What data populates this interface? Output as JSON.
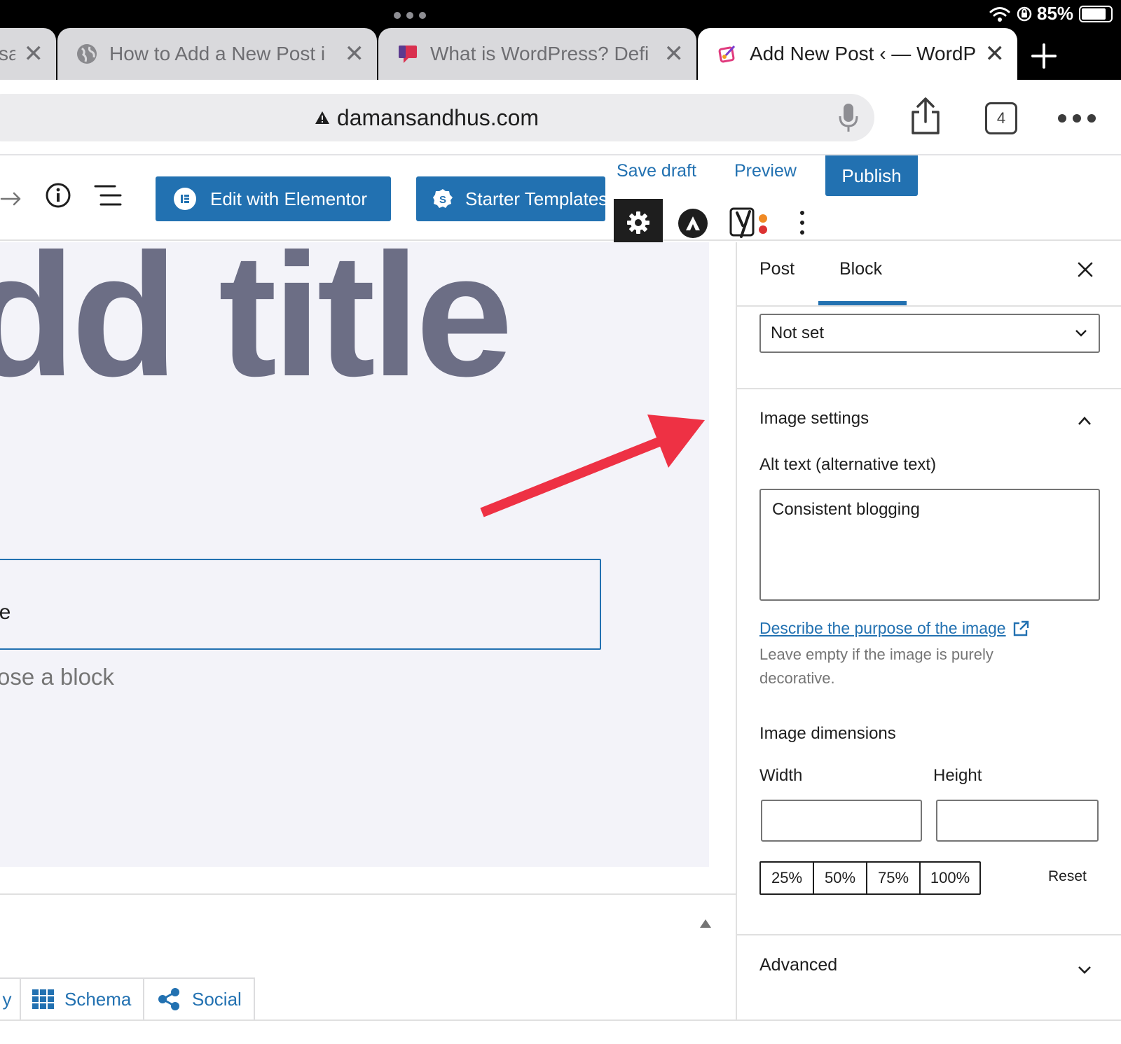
{
  "status_bar": {
    "battery": "85%"
  },
  "tabs": [
    {
      "title": "sa",
      "active": false
    },
    {
      "title": "How to Add a New Post i",
      "active": false
    },
    {
      "title": "What is WordPress? Defi",
      "active": false
    },
    {
      "title": "Add New Post ‹ — WordP",
      "active": true
    }
  ],
  "address_bar": {
    "url": "damansandhus.com",
    "tab_count": "4"
  },
  "toolbar": {
    "edit_elementor_label": "Edit with Elementor",
    "starter_templates_label": "Starter Templates",
    "save_draft_label": "Save draft",
    "preview_label": "Preview",
    "publish_label": "Publish"
  },
  "canvas": {
    "title_placeholder": "dd title",
    "image_block_text": "le",
    "choose_block_text": "ose a block"
  },
  "sidebar": {
    "tabs": [
      "Post",
      "Block"
    ],
    "active_tab": "Block",
    "select_value": "Not set",
    "image_settings_heading": "Image settings",
    "alt_text_label": "Alt text (alternative text)",
    "alt_text_value": "Consistent blogging",
    "describe_link": "Describe the purpose of the image",
    "help_text": "Leave empty if the image is purely decorative.",
    "dimensions_heading": "Image dimensions",
    "width_label": "Width",
    "height_label": "Height",
    "width_value": "",
    "height_value": "",
    "percent_buttons": [
      "25%",
      "50%",
      "75%",
      "100%"
    ],
    "reset_label": "Reset",
    "advanced_heading": "Advanced"
  },
  "meta_tabs": {
    "partial_label": "y",
    "schema_label": "Schema",
    "social_label": "Social"
  },
  "colors": {
    "accent": "#2271b1",
    "arrow": "#ee3144",
    "canvas_bg": "#f3f3f9",
    "title_text": "#6c6e85"
  }
}
